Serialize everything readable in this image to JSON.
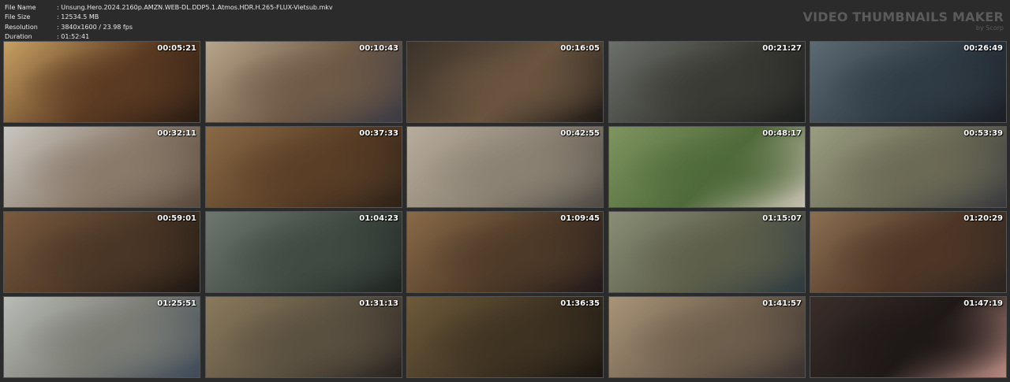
{
  "file_info": [
    {
      "label": "File Name",
      "value": ":  Unsung.Hero.2024.2160p.AMZN.WEB-DL.DDP5.1.Atmos.HDR.H.265-FLUX-Vietsub.mkv"
    },
    {
      "label": "File Size",
      "value": ":  12534.5 MB"
    },
    {
      "label": "Resolution",
      "value": ":  3840x1600 / 23.98 fps"
    },
    {
      "label": "Duration",
      "value": ":  01:52:41"
    }
  ],
  "brand": {
    "title": "VIDEO THUMBNAILS MAKER",
    "subtitle": "by Scorp"
  },
  "thumbnails": [
    {
      "time": "00:05:21",
      "colors": [
        "#c7a062",
        "#5b3a22",
        "#2a1c12"
      ]
    },
    {
      "time": "00:10:43",
      "colors": [
        "#b7a58a",
        "#6f5a46",
        "#3b3a44"
      ]
    },
    {
      "time": "00:16:05",
      "colors": [
        "#3b332a",
        "#6a543f",
        "#1e1a16"
      ]
    },
    {
      "time": "00:21:27",
      "colors": [
        "#6c706a",
        "#3a3a34",
        "#1d1f1e"
      ]
    },
    {
      "time": "00:26:49",
      "colors": [
        "#5c6a74",
        "#2f3b45",
        "#1a1f24"
      ]
    },
    {
      "time": "00:32:11",
      "colors": [
        "#c9c6c0",
        "#8a7a6a",
        "#5a4a3e"
      ]
    },
    {
      "time": "00:37:33",
      "colors": [
        "#8a6a46",
        "#5a3e26",
        "#2e2218"
      ]
    },
    {
      "time": "00:42:55",
      "colors": [
        "#b8ad9c",
        "#8b8172",
        "#4e4a44"
      ]
    },
    {
      "time": "00:48:17",
      "colors": [
        "#7f9560",
        "#4f6a3a",
        "#c7c0b0"
      ]
    },
    {
      "time": "00:53:39",
      "colors": [
        "#9a9d80",
        "#6b6a55",
        "#3a3a3e"
      ]
    },
    {
      "time": "00:59:01",
      "colors": [
        "#7a5a3e",
        "#4a3626",
        "#1e1712"
      ]
    },
    {
      "time": "01:04:23",
      "colors": [
        "#6e7670",
        "#3f4a42",
        "#1f2421"
      ]
    },
    {
      "time": "01:09:45",
      "colors": [
        "#8a6a48",
        "#4e3a28",
        "#22191a"
      ]
    },
    {
      "time": "01:15:07",
      "colors": [
        "#8a8e76",
        "#5c5e4a",
        "#2e3a40"
      ]
    },
    {
      "time": "01:20:29",
      "colors": [
        "#8c6f52",
        "#4e3626",
        "#2a2420"
      ]
    },
    {
      "time": "01:25:51",
      "colors": [
        "#b9bbb6",
        "#7a7c74",
        "#3e4a58"
      ]
    },
    {
      "time": "01:31:13",
      "colors": [
        "#8b7a5c",
        "#5a5040",
        "#2a2420"
      ]
    },
    {
      "time": "01:36:35",
      "colors": [
        "#6e5a3a",
        "#3e3222",
        "#1a1610"
      ]
    },
    {
      "time": "01:41:57",
      "colors": [
        "#a89478",
        "#6e5e4c",
        "#3a3230"
      ]
    },
    {
      "time": "01:47:19",
      "colors": [
        "#3a2e2a",
        "#1e1816",
        "#b88a82"
      ]
    }
  ]
}
